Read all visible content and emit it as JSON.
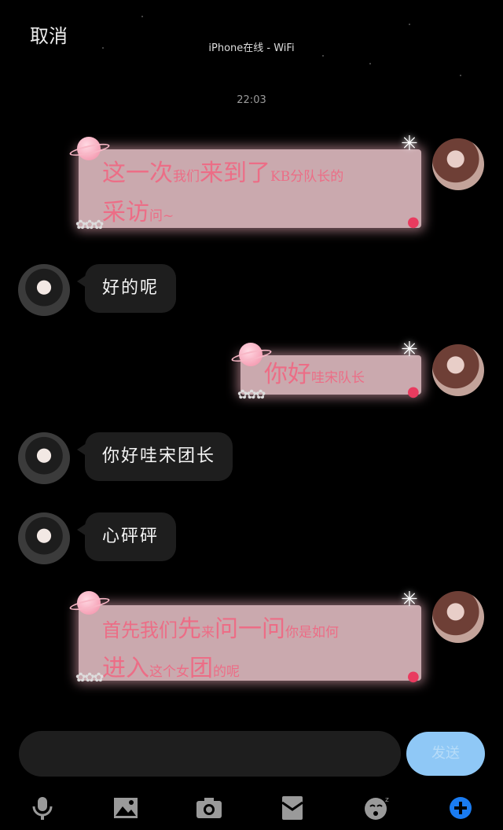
{
  "header": {
    "cancel_label": "取消",
    "status": "iPhone在线 - WiFi"
  },
  "timestamp": "22:03",
  "messages": [
    {
      "side": "right",
      "type": "sticker",
      "line1_big": "这一次",
      "line1_small": "我们",
      "line1_big2": "来到了",
      "line1_small2": "KB分队长的",
      "line2_big": "采访",
      "line2_small": "问~"
    },
    {
      "side": "left",
      "type": "text",
      "text": "好的呢"
    },
    {
      "side": "right",
      "type": "sticker",
      "line1_big": "你好",
      "line1_small": "哇宋队长"
    },
    {
      "side": "left",
      "type": "text",
      "text": "你好哇宋团长"
    },
    {
      "side": "left",
      "type": "text",
      "text": "心砰砰"
    },
    {
      "side": "right",
      "type": "sticker",
      "line1_big": "首先我们",
      "line1_big2": "先",
      "line1_small": "来",
      "line1_big3": "问一问",
      "line1_small2": "你是如何",
      "line2_big": "进入",
      "line2_small": "这个女",
      "line2_big2": "团",
      "line2_small2": "的呢"
    }
  ],
  "input": {
    "send_label": "发送"
  },
  "toolbar": [
    "microphone-icon",
    "image-icon",
    "camera-icon",
    "red-envelope-icon",
    "emoji-icon",
    "plus-icon"
  ],
  "colors": {
    "accent": "#1a7cf2",
    "send_disabled": "#8fc8f6",
    "sticker_text": "#ec6d86"
  }
}
